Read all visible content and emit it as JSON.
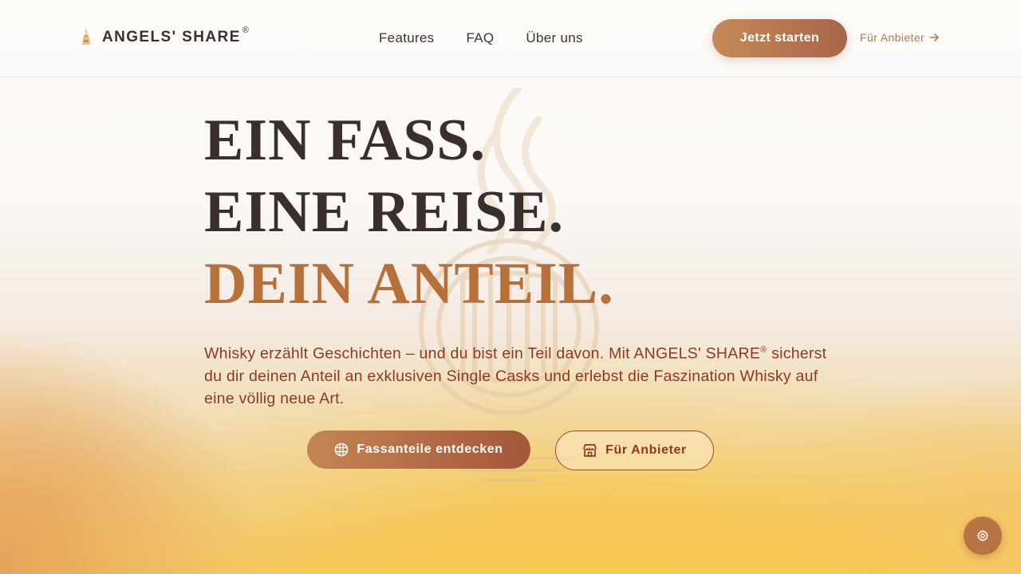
{
  "brand": {
    "name": "ANGELS' SHARE",
    "reg_mark": "®",
    "logo_icon": "angel-bottle-icon"
  },
  "nav": {
    "items": [
      {
        "label": "Features"
      },
      {
        "label": "FAQ"
      },
      {
        "label": "Über uns"
      }
    ]
  },
  "header": {
    "cta_label": "Jetzt starten",
    "provider_link": "Für Anbieter",
    "provider_icon": "arrow-right-icon"
  },
  "hero": {
    "line1": "EIN FASS.",
    "line2": "EINE REISE.",
    "line3": "DEIN ANTEIL.",
    "lead_part1": "Whisky erzählt Geschichten – und du bist ein Teil davon. Mit ANGELS' SHARE",
    "lead_reg": "®",
    "lead_part2": " sicherst du dir deinen Anteil an exklusiven Single Casks und erlebst die Faszination Whisky auf eine völlig neue Art.",
    "primary_button": {
      "label": "Fassanteile entdecken",
      "icon": "barrel-icon"
    },
    "secondary_button": {
      "label": "Für Anbieter",
      "icon": "storefront-icon"
    }
  },
  "fab": {
    "icon": "gear-icon"
  },
  "colors": {
    "accent": "#b6713a",
    "text_dark": "#3a2f2e",
    "lead_text": "#8b3a22",
    "button_start": "#c48553",
    "button_end": "#a5573a"
  }
}
